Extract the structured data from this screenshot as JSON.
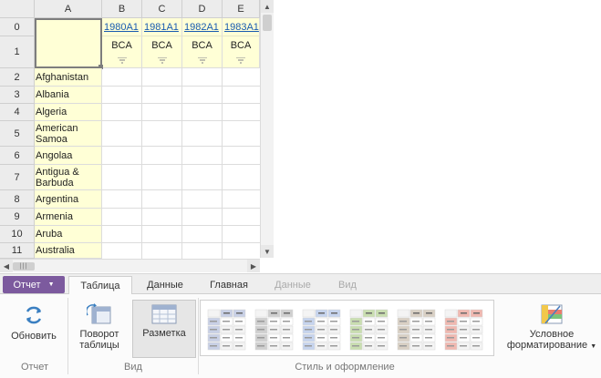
{
  "grid": {
    "column_headers": [
      "A",
      "B",
      "C",
      "D",
      "E"
    ],
    "row_headers": [
      "0",
      "1",
      "2",
      "3",
      "4",
      "5",
      "6",
      "7",
      "8",
      "9",
      "10",
      "11"
    ],
    "year_headers": [
      "1980A1",
      "1981A1",
      "1982A1",
      "1983A1"
    ],
    "measure_label": "BCA",
    "countries": [
      "Afghanistan",
      "Albania",
      "Algeria",
      "American Samoa",
      "Angolaa",
      "Antigua & Barbuda",
      "Argentina",
      "Armenia",
      "Aruba",
      "Australia"
    ]
  },
  "ribbon": {
    "report_button": "Отчет",
    "tabs": [
      {
        "label": "Таблица",
        "state": "active"
      },
      {
        "label": "Данные",
        "state": "normal"
      },
      {
        "label": "Главная",
        "state": "normal"
      },
      {
        "label": "Данные",
        "state": "disabled"
      },
      {
        "label": "Вид",
        "state": "disabled"
      }
    ],
    "buttons": {
      "refresh": "Обновить",
      "pivot_line1": "Поворот",
      "pivot_line2": "таблицы",
      "layout": "Разметка",
      "cond_line1": "Условное",
      "cond_line2": "форматирование"
    },
    "groups": {
      "report": "Отчет",
      "view": "Вид",
      "style": "Стиль и оформление"
    },
    "style_gallery_accents": [
      "#c8d0e6",
      "#cfcfcf",
      "#c6d4ee",
      "#c9deb0",
      "#d9d0c4",
      "#f0b8b0"
    ]
  },
  "colors": {
    "report_button": "#7c5a9e",
    "header_yellow": "#ffffd6",
    "link_blue": "#1a5cb0"
  }
}
